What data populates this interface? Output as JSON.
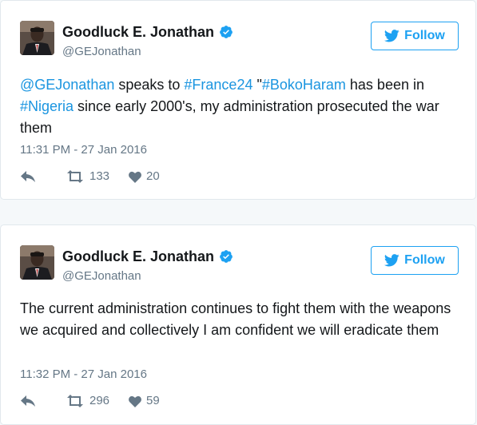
{
  "tweets": [
    {
      "author": {
        "name": "Goodluck E. Jonathan",
        "handle": "@GEJonathan",
        "verified_icon": "verified-badge-icon"
      },
      "follow_label": "Follow",
      "text_segments": [
        {
          "text": "@GEJonathan",
          "type": "link"
        },
        {
          "text": " speaks to ",
          "type": "plain"
        },
        {
          "text": "#France24",
          "type": "link"
        },
        {
          "text": " \"",
          "type": "plain"
        },
        {
          "text": "#BokoHaram",
          "type": "link"
        },
        {
          "text": " has been in ",
          "type": "plain"
        },
        {
          "text": "#Nigeria",
          "type": "link"
        },
        {
          "text": " since early 2000's, my administration prosecuted the war them",
          "type": "plain"
        }
      ],
      "timestamp": "11:31 PM - 27 Jan 2016",
      "retweets": "133",
      "likes": "20"
    },
    {
      "author": {
        "name": "Goodluck E. Jonathan",
        "handle": "@GEJonathan",
        "verified_icon": "verified-badge-icon"
      },
      "follow_label": "Follow",
      "text_segments": [
        {
          "text": "The current administration continues to fight them with the weapons we acquired and collectively I am confident we will eradicate them",
          "type": "plain"
        }
      ],
      "timestamp": "11:32 PM - 27 Jan 2016",
      "retweets": "296",
      "likes": "59"
    }
  ],
  "colors": {
    "accent": "#1da1f2",
    "link": "#1b95e0",
    "muted": "#657786",
    "text": "#14171a"
  },
  "icons": {
    "reply": "reply-icon",
    "retweet": "retweet-icon",
    "like": "heart-icon",
    "follow": "twitter-bird-icon"
  }
}
